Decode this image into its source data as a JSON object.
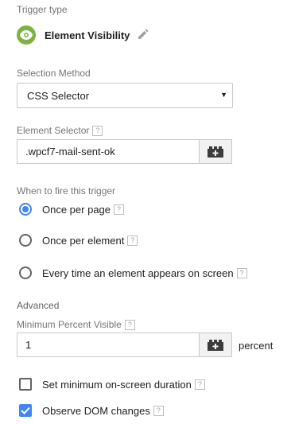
{
  "trigger_type": {
    "label": "Trigger type",
    "name": "Element Visibility",
    "icon": "eye-icon",
    "icon_color": "#7cb342",
    "edit_icon": "pencil-icon"
  },
  "selection_method": {
    "label": "Selection Method",
    "value": "CSS Selector",
    "arrow": "▼"
  },
  "element_selector": {
    "label": "Element Selector",
    "help": "?",
    "value": ".wpcf7-mail-sent-ok",
    "variable_icon": "lego-block-icon"
  },
  "fire": {
    "label": "When to fire this trigger",
    "options": [
      {
        "label": "Once per page",
        "checked": true,
        "help": "?"
      },
      {
        "label": "Once per element",
        "checked": false,
        "help": "?"
      },
      {
        "label": "Every time an element appears on screen",
        "checked": false,
        "help": "?"
      }
    ]
  },
  "advanced": {
    "label": "Advanced",
    "min_percent_label": "Minimum Percent Visible",
    "help": "?",
    "min_percent_value": "1",
    "unit": "percent",
    "variable_icon": "lego-block-icon",
    "checkboxes": [
      {
        "label": "Set minimum on-screen duration",
        "checked": false,
        "help": "?"
      },
      {
        "label": "Observe DOM changes",
        "checked": true,
        "help": "?"
      }
    ]
  },
  "colors": {
    "accent": "#4285f4",
    "trigger_green": "#7cb342"
  }
}
